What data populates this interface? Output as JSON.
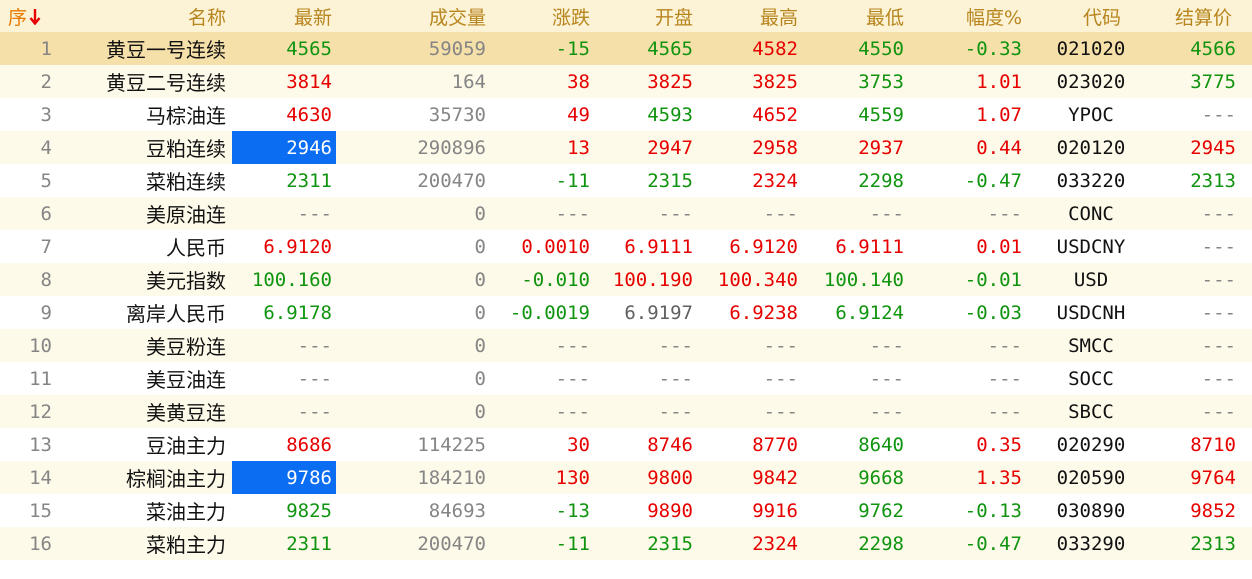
{
  "header": {
    "index_label": "序",
    "sort_icon": "sort-desc-icon",
    "columns": {
      "name": "名称",
      "latest": "最新",
      "volume": "成交量",
      "change": "涨跌",
      "open": "开盘",
      "high": "最高",
      "low": "最低",
      "pct": "幅度%",
      "code": "代码",
      "settle": "结算价"
    }
  },
  "palette": {
    "text": "#111111",
    "muted": "#858585",
    "header_text": "#b8861e",
    "sort_label": "#e67a00",
    "sort_icon": "#e60000",
    "header_bg": "#fcf2d6",
    "row_bg": "#ffffff",
    "alt_row_bg": "#fefae9",
    "selected_row_bg": "#f6e0a9",
    "flash_bg": "#0b6df2",
    "flash_text": "#ffffff"
  },
  "rows": [
    {
      "index": "1",
      "name": "黄豆一号连续",
      "latest": "4565",
      "volume": "59059",
      "change": "-15",
      "open": "4565",
      "high": "4582",
      "low": "4550",
      "pct": "-0.33",
      "code": "021020",
      "settle": "4566",
      "selected": true,
      "colors": {
        "latest": "#109410",
        "change": "#109410",
        "open": "#109410",
        "high": "#e60000",
        "low": "#109410",
        "pct": "#109410",
        "settle": "#109410"
      }
    },
    {
      "index": "2",
      "name": "黄豆二号连续",
      "latest": "3814",
      "volume": "164",
      "change": "38",
      "open": "3825",
      "high": "3825",
      "low": "3753",
      "pct": "1.01",
      "code": "023020",
      "settle": "3775",
      "colors": {
        "latest": "#e60000",
        "change": "#e60000",
        "open": "#e60000",
        "high": "#e60000",
        "low": "#109410",
        "pct": "#e60000",
        "settle": "#109410"
      }
    },
    {
      "index": "3",
      "name": "马棕油连",
      "latest": "4630",
      "volume": "35730",
      "change": "49",
      "open": "4593",
      "high": "4652",
      "low": "4559",
      "pct": "1.07",
      "code": "YPOC",
      "settle": "---",
      "colors": {
        "latest": "#e60000",
        "change": "#e60000",
        "open": "#109410",
        "high": "#e60000",
        "low": "#109410",
        "pct": "#e60000"
      }
    },
    {
      "index": "4",
      "name": "豆粕连续",
      "latest": "2946",
      "volume": "290896",
      "change": "13",
      "open": "2947",
      "high": "2958",
      "low": "2937",
      "pct": "0.44",
      "code": "020120",
      "settle": "2945",
      "latest_highlighted": true,
      "colors": {
        "latest": "#e60000",
        "change": "#e60000",
        "open": "#e60000",
        "high": "#e60000",
        "low": "#e60000",
        "pct": "#e60000",
        "settle": "#e60000"
      }
    },
    {
      "index": "5",
      "name": "菜粕连续",
      "latest": "2311",
      "volume": "200470",
      "change": "-11",
      "open": "2315",
      "high": "2324",
      "low": "2298",
      "pct": "-0.47",
      "code": "033220",
      "settle": "2313",
      "colors": {
        "latest": "#109410",
        "change": "#109410",
        "open": "#109410",
        "high": "#e60000",
        "low": "#109410",
        "pct": "#109410",
        "settle": "#109410"
      }
    },
    {
      "index": "6",
      "name": "美原油连",
      "latest": "---",
      "volume": "0",
      "change": "---",
      "open": "---",
      "high": "---",
      "low": "---",
      "pct": "---",
      "code": "CONC",
      "settle": "---"
    },
    {
      "index": "7",
      "name": "人民币",
      "latest": "6.9120",
      "volume": "0",
      "change": "0.0010",
      "open": "6.9111",
      "high": "6.9120",
      "low": "6.9111",
      "pct": "0.01",
      "code": "USDCNY",
      "settle": "---",
      "colors": {
        "latest": "#e60000",
        "change": "#e60000",
        "open": "#e60000",
        "high": "#e60000",
        "low": "#e60000",
        "pct": "#e60000"
      }
    },
    {
      "index": "8",
      "name": "美元指数",
      "latest": "100.160",
      "volume": "0",
      "change": "-0.010",
      "open": "100.190",
      "high": "100.340",
      "low": "100.140",
      "pct": "-0.01",
      "code": "USD",
      "settle": "---",
      "colors": {
        "latest": "#109410",
        "change": "#109410",
        "open": "#e60000",
        "high": "#e60000",
        "low": "#109410",
        "pct": "#109410"
      }
    },
    {
      "index": "9",
      "name": "离岸人民币",
      "latest": "6.9178",
      "volume": "0",
      "change": "-0.0019",
      "open": "6.9197",
      "high": "6.9238",
      "low": "6.9124",
      "pct": "-0.03",
      "code": "USDCNH",
      "settle": "---",
      "colors": {
        "latest": "#109410",
        "change": "#109410",
        "open": "#606060",
        "high": "#e60000",
        "low": "#109410",
        "pct": "#109410"
      }
    },
    {
      "index": "10",
      "name": "美豆粉连",
      "latest": "---",
      "volume": "0",
      "change": "---",
      "open": "---",
      "high": "---",
      "low": "---",
      "pct": "---",
      "code": "SMCC",
      "settle": "---"
    },
    {
      "index": "11",
      "name": "美豆油连",
      "latest": "---",
      "volume": "0",
      "change": "---",
      "open": "---",
      "high": "---",
      "low": "---",
      "pct": "---",
      "code": "SOCC",
      "settle": "---"
    },
    {
      "index": "12",
      "name": "美黄豆连",
      "latest": "---",
      "volume": "0",
      "change": "---",
      "open": "---",
      "high": "---",
      "low": "---",
      "pct": "---",
      "code": "SBCC",
      "settle": "---"
    },
    {
      "index": "13",
      "name": "豆油主力",
      "latest": "8686",
      "volume": "114225",
      "change": "30",
      "open": "8746",
      "high": "8770",
      "low": "8640",
      "pct": "0.35",
      "code": "020290",
      "settle": "8710",
      "colors": {
        "latest": "#e60000",
        "change": "#e60000",
        "open": "#e60000",
        "high": "#e60000",
        "low": "#109410",
        "pct": "#e60000",
        "settle": "#e60000"
      }
    },
    {
      "index": "14",
      "name": "棕榈油主力",
      "latest": "9786",
      "volume": "184210",
      "change": "130",
      "open": "9800",
      "high": "9842",
      "low": "9668",
      "pct": "1.35",
      "code": "020590",
      "settle": "9764",
      "latest_highlighted": true,
      "colors": {
        "latest": "#e60000",
        "change": "#e60000",
        "open": "#e60000",
        "high": "#e60000",
        "low": "#109410",
        "pct": "#e60000",
        "settle": "#e60000"
      }
    },
    {
      "index": "15",
      "name": "菜油主力",
      "latest": "9825",
      "volume": "84693",
      "change": "-13",
      "open": "9890",
      "high": "9916",
      "low": "9762",
      "pct": "-0.13",
      "code": "030890",
      "settle": "9852",
      "colors": {
        "latest": "#109410",
        "change": "#109410",
        "open": "#e60000",
        "high": "#e60000",
        "low": "#109410",
        "pct": "#109410",
        "settle": "#e60000"
      }
    },
    {
      "index": "16",
      "name": "菜粕主力",
      "latest": "2311",
      "volume": "200470",
      "change": "-11",
      "open": "2315",
      "high": "2324",
      "low": "2298",
      "pct": "-0.47",
      "code": "033290",
      "settle": "2313",
      "colors": {
        "latest": "#109410",
        "change": "#109410",
        "open": "#109410",
        "high": "#e60000",
        "low": "#109410",
        "pct": "#109410",
        "settle": "#109410"
      }
    }
  ]
}
